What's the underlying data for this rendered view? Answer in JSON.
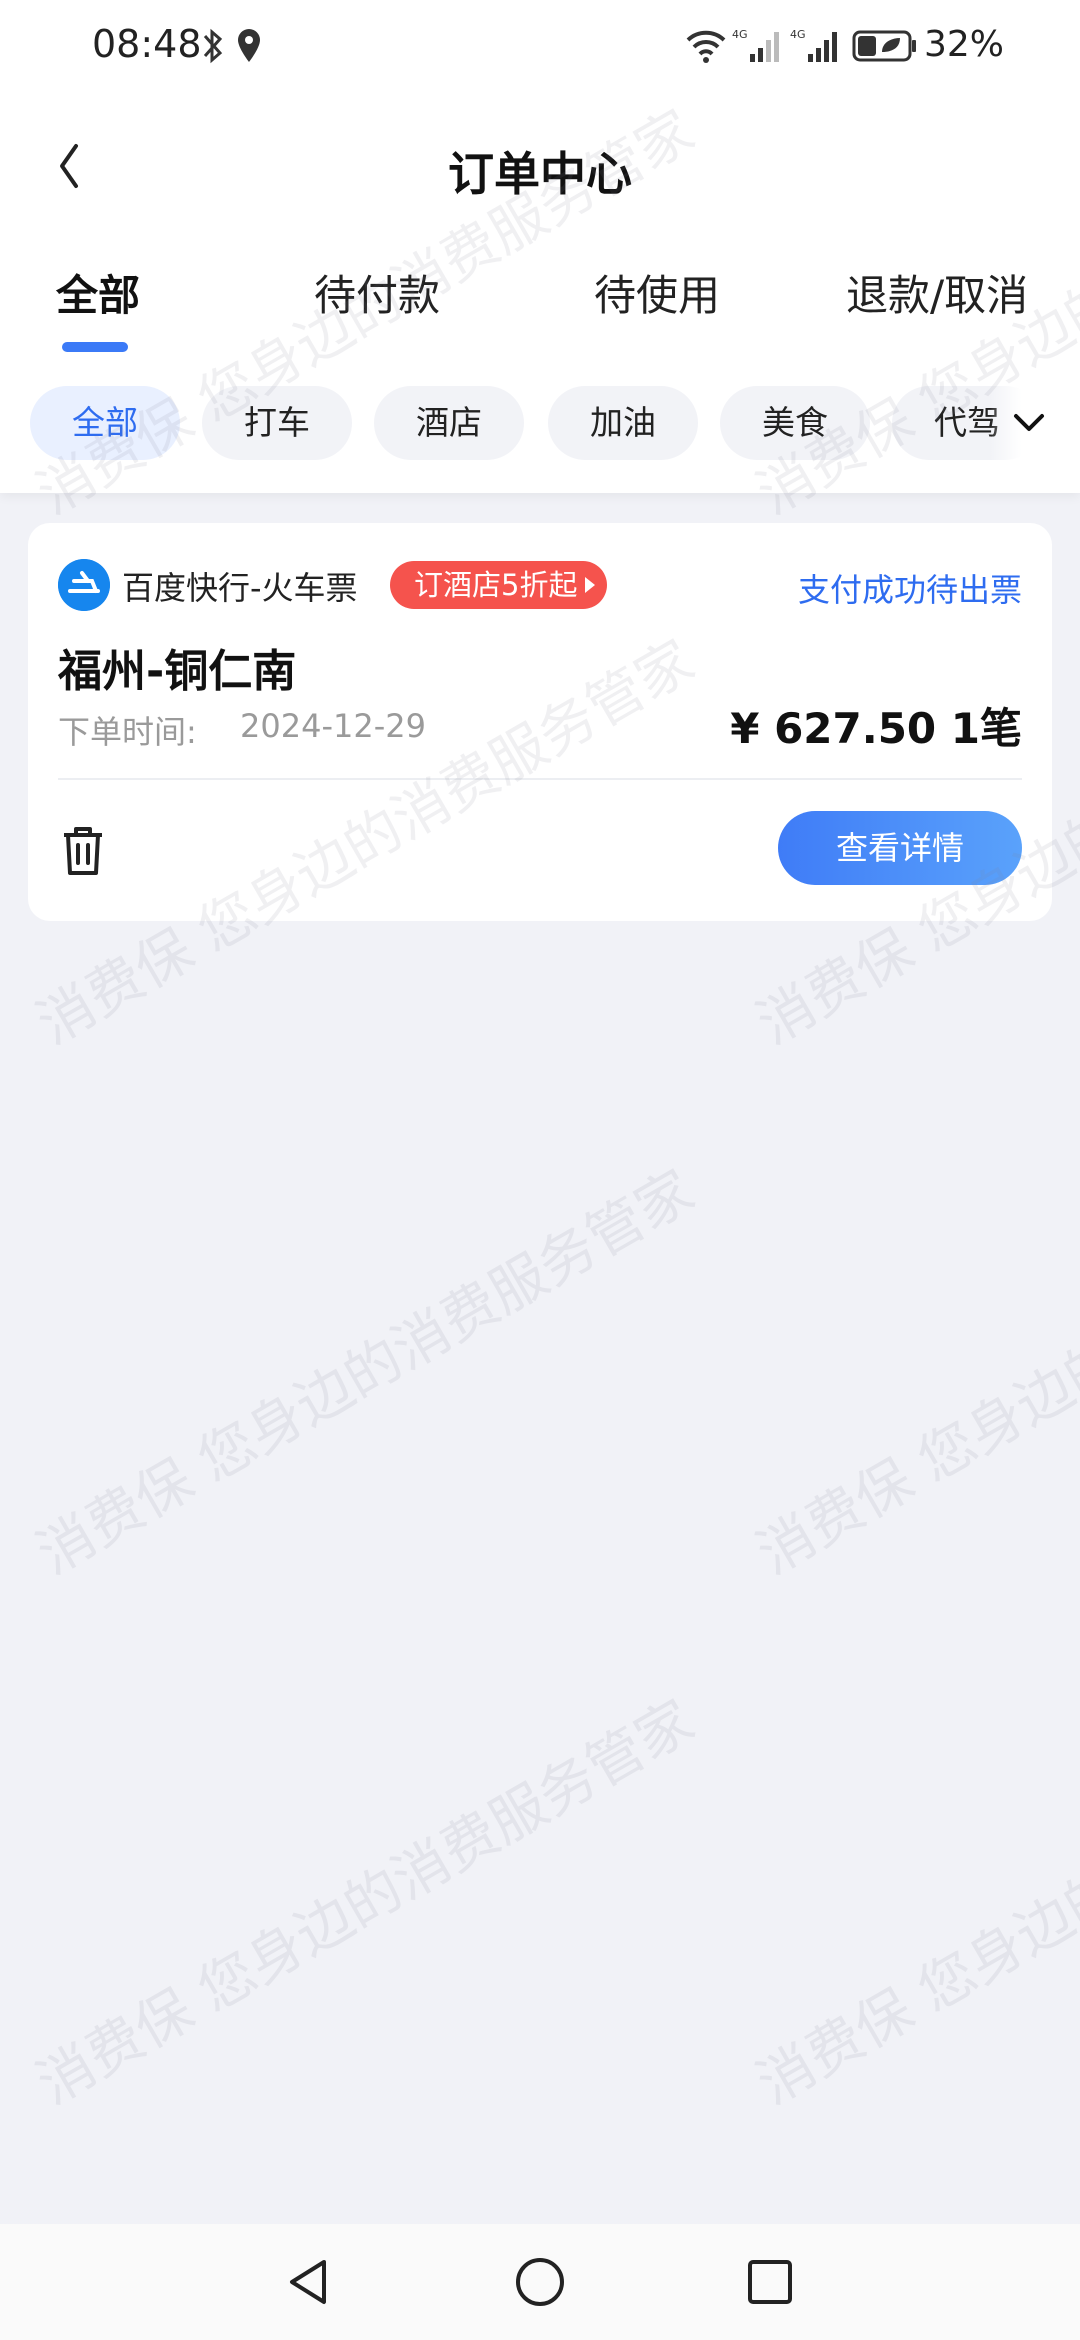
{
  "status_bar": {
    "time": "08:48",
    "battery_text": "32%"
  },
  "header": {
    "title": "订单中心"
  },
  "tabs": [
    {
      "label": "全部",
      "active": true
    },
    {
      "label": "待付款"
    },
    {
      "label": "待使用"
    },
    {
      "label": "退款/取消"
    }
  ],
  "chips": [
    {
      "label": "全部",
      "active": true
    },
    {
      "label": "打车"
    },
    {
      "label": "酒店"
    },
    {
      "label": "加油"
    },
    {
      "label": "美食"
    },
    {
      "label": "代驾"
    }
  ],
  "order": {
    "app_name": "百度快行-火车票",
    "promo": "订酒店5折起",
    "status": "支付成功待出票",
    "route": "福州-铜仁南",
    "time_label": "下单时间:",
    "time_value": "2024-12-29",
    "price": "¥ 627.50 1笔",
    "detail_button": "查看详情"
  },
  "watermark": {
    "text": "消费保 您身边的消费服务管家"
  },
  "colors": {
    "accent": "#3b7af7",
    "promo_red": "#f5534d",
    "background": "#f1f2f7"
  }
}
